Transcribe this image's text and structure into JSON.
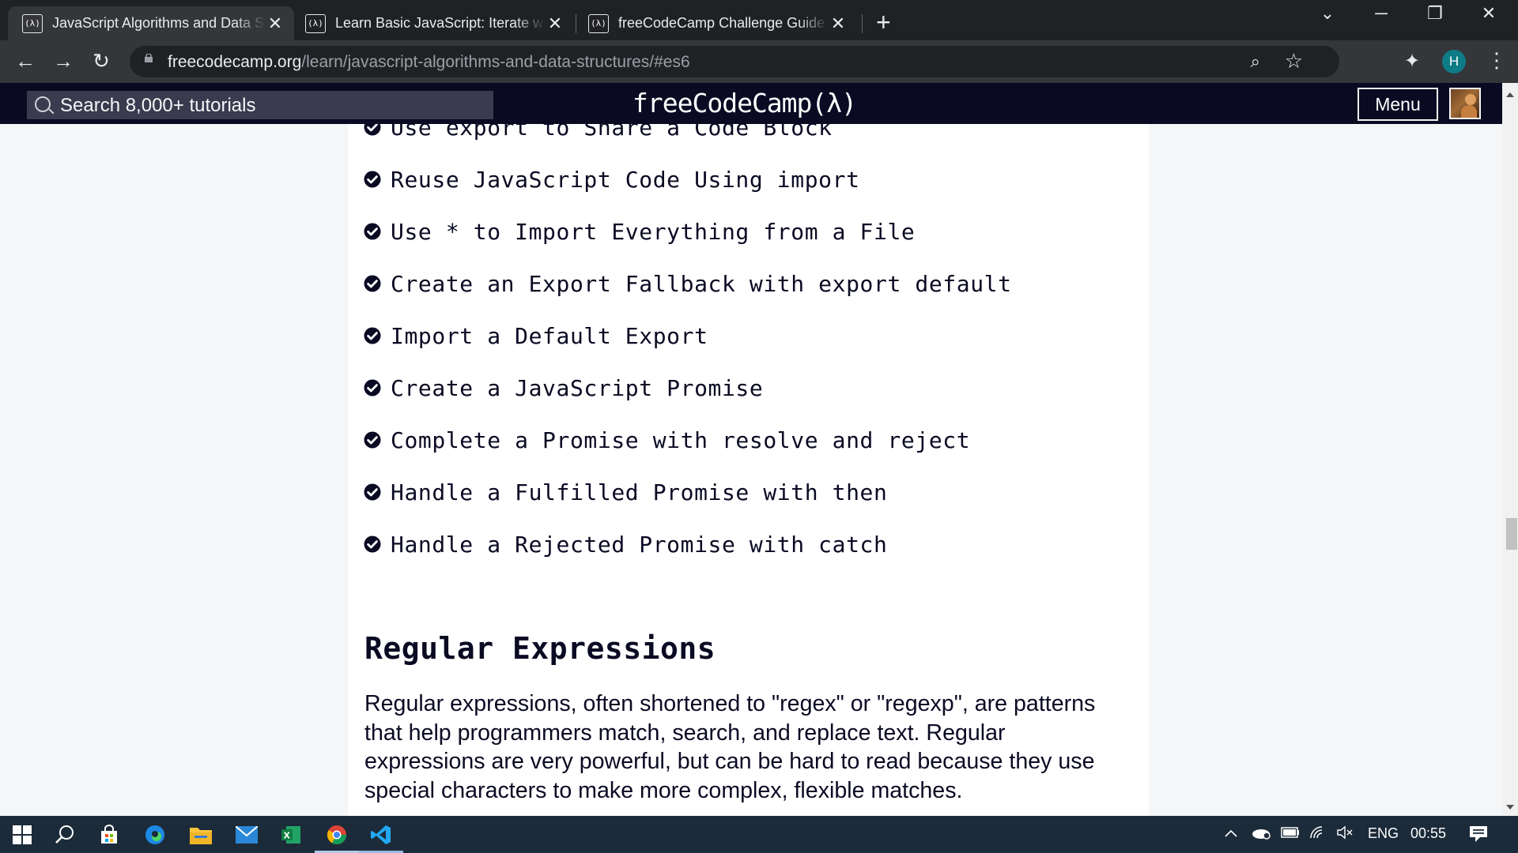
{
  "browser": {
    "tabs": [
      {
        "favicon": "(λ)",
        "title": "JavaScript Algorithms and Data Structures",
        "close": "✕"
      },
      {
        "favicon": "(λ)",
        "title": "Learn Basic JavaScript: Iterate with",
        "close": "✕"
      },
      {
        "favicon": "(λ)",
        "title": "freeCodeCamp Challenge Guide:",
        "close": "✕"
      }
    ],
    "new_tab": "+",
    "window_controls": {
      "dropdown": "⌄",
      "minimize": "─",
      "restore": "❐",
      "close": "✕"
    },
    "nav": {
      "back": "←",
      "forward": "→",
      "reload": "↻"
    },
    "url_host": "freecodecamp.org",
    "url_path": "/learn/javascript-algorithms-and-data-structures/#es6",
    "zoom": "⌕",
    "bookmark": "☆",
    "extensions": "✦",
    "profile_initial": "H",
    "menu": "⋮"
  },
  "fcc_nav": {
    "search_placeholder": "Search 8,000+ tutorials",
    "brand": "freeCodeCamp(λ)",
    "menu_label": "Menu"
  },
  "es6_items": [
    "Use export to Share a Code Block",
    "Reuse JavaScript Code Using import",
    "Use * to Import Everything from a File",
    "Create an Export Fallback with export default",
    "Import a Default Export",
    "Create a JavaScript Promise",
    "Complete a Promise with resolve and reject",
    "Handle a Fulfilled Promise with then",
    "Handle a Rejected Promise with catch"
  ],
  "regex_section": {
    "title": "Regular Expressions",
    "intro": "Regular expressions, often shortened to \"regex\" or \"regexp\", are patterns that help programmers match, search, and replace text. Regular expressions are very powerful, but can be hard to read because they use special characters to make more complex, flexible matches."
  },
  "taskbar": {
    "apps": [
      "windows-start",
      "search",
      "store",
      "edge",
      "file-explorer",
      "mail",
      "excel",
      "chrome",
      "vscode"
    ],
    "tray": {
      "language": "ENG",
      "time": "00:55"
    }
  },
  "colors": {
    "fcc_dark": "#0a0a23",
    "page_bg": "#f5f6f7",
    "chrome_dark": "#202124",
    "chrome_toolbar": "#35363a",
    "taskbar": "#1c2b3a"
  }
}
